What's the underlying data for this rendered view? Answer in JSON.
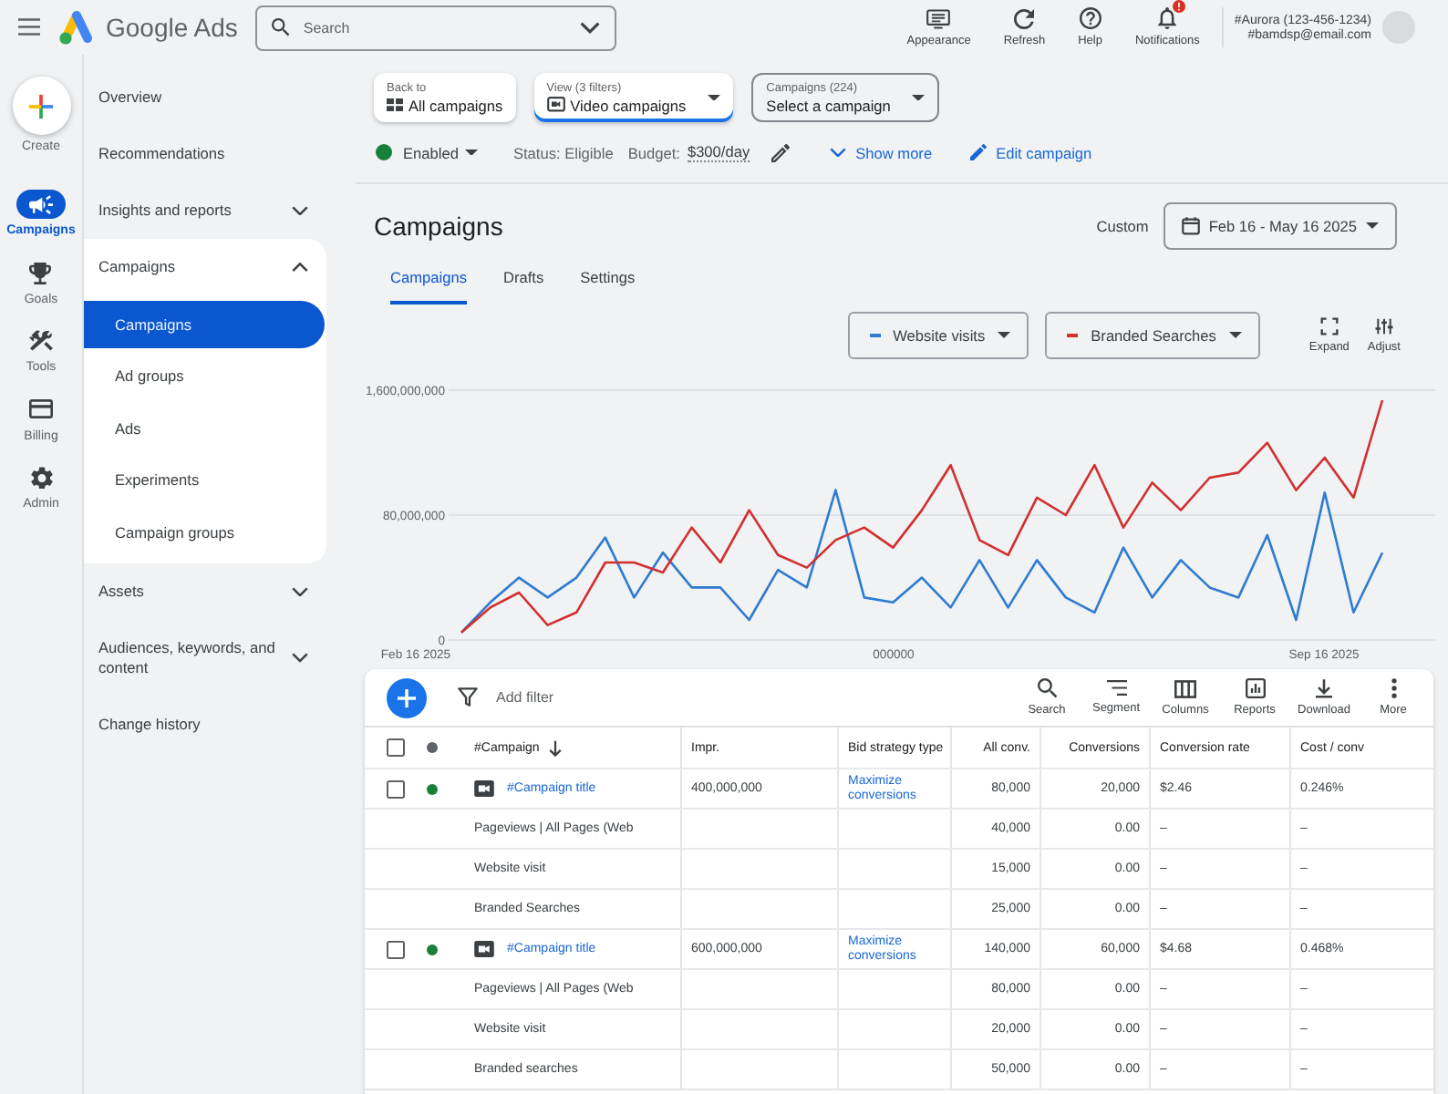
{
  "topbar": {
    "title": "Google Ads",
    "search": {
      "placeholder": "Search"
    },
    "actions": [
      {
        "label": "Appearance",
        "alert": false
      },
      {
        "label": "Refresh",
        "alert": false
      },
      {
        "label": "Help",
        "alert": false
      },
      {
        "label": "Notifications",
        "alert": true
      }
    ],
    "account": {
      "name": "#Aurora (123-456-1234)",
      "email": "#bamdsp@email.com"
    }
  },
  "rail": {
    "create": "Create",
    "items": [
      {
        "label": "Campaigns",
        "selected": true
      },
      {
        "label": "Goals",
        "selected": false
      },
      {
        "label": "Tools",
        "selected": false
      },
      {
        "label": "Billing",
        "selected": false
      },
      {
        "label": "Admin",
        "selected": false
      }
    ]
  },
  "sidebar": {
    "items": [
      {
        "label": "Overview",
        "selected": false
      },
      {
        "label": "Recommendations",
        "selected": false
      },
      {
        "label": "Insights and reports",
        "selected": false,
        "expanded": false
      },
      {
        "label": "Campaigns",
        "selected": false,
        "expanded": true,
        "children": [
          {
            "label": "Campaigns",
            "selected": true
          },
          {
            "label": "Ad groups",
            "selected": false
          },
          {
            "label": "Ads",
            "selected": false
          },
          {
            "label": "Experiments",
            "selected": false
          },
          {
            "label": "Campaign groups",
            "selected": false
          }
        ]
      },
      {
        "label": "Assets",
        "selected": false,
        "expanded": false
      },
      {
        "label": "Audiences, keywords, and content",
        "selected": false,
        "expanded": false
      },
      {
        "label": "Change history",
        "selected": false
      }
    ]
  },
  "context_bar": {
    "back": {
      "caption": "Back to",
      "label": "All campaigns"
    },
    "view": {
      "caption": "View (3 filters)",
      "label": "Video campaigns"
    },
    "campaign_picker": {
      "caption": "Campaigns (224)",
      "label": "Select a campaign"
    }
  },
  "campaign_status": {
    "status": "Enabled",
    "enabled": true,
    "eligibility": "Status: Eligible",
    "budget_label": "Budget:",
    "budget": "$300/day",
    "show_more": "Show more",
    "edit": "Edit campaign"
  },
  "page": {
    "title": "Campaigns",
    "date_label": "Custom",
    "date_range": "Feb 16 - May 16 2025",
    "tabs": [
      {
        "label": "Campaigns",
        "selected": true
      },
      {
        "label": "Drafts",
        "selected": false
      },
      {
        "label": "Settings",
        "selected": false
      }
    ]
  },
  "chart": {
    "metrics": [
      {
        "name": "Website visits",
        "color": "#2f7bd0"
      },
      {
        "name": "Branded Searches",
        "color": "#d32f2f"
      }
    ],
    "tools": [
      "Expand",
      "Adjust"
    ],
    "y_labels": [
      "1,600,000,000",
      "80,000,000",
      "0"
    ],
    "x_labels": [
      "Feb 16 2025",
      "000000",
      "Sep 16 2025"
    ]
  },
  "table": {
    "add_filter": "Add filter",
    "tools": [
      "Search",
      "Segment",
      "Columns",
      "Reports",
      "Download",
      "More"
    ],
    "all_checked": false,
    "columns": [
      {
        "label": "#Campaign",
        "sorted": true
      },
      {
        "label": "Impr.",
        "sorted": false
      },
      {
        "label": "Bid strategy type",
        "sorted": false
      },
      {
        "label": "All conv.",
        "sorted": false
      },
      {
        "label": "Conversions",
        "sorted": false
      },
      {
        "label": "Conversion rate",
        "sorted": false
      },
      {
        "label": "Cost / conv",
        "sorted": false
      }
    ],
    "rows": [
      {
        "kind": "campaign",
        "checked": false,
        "enabled": true,
        "name": "#Campaign title",
        "impr": "400,000,000",
        "bid_strategy": "Maximize conversions",
        "all_conv": "80,000",
        "conversions": "20,000",
        "conv_rate": "$2.46",
        "cost_per_conv": "0.246%"
      },
      {
        "kind": "conversion_action",
        "name": "Pageviews | All Pages (Web",
        "all_conv": "40,000",
        "conversions": "0.00",
        "conv_rate": "–",
        "cost_per_conv": "–"
      },
      {
        "kind": "conversion_action",
        "name": "Website visit",
        "all_conv": "15,000",
        "conversions": "0.00",
        "conv_rate": "–",
        "cost_per_conv": "–"
      },
      {
        "kind": "conversion_action",
        "name": "Branded Searches",
        "all_conv": "25,000",
        "conversions": "0.00",
        "conv_rate": "–",
        "cost_per_conv": "–"
      },
      {
        "kind": "campaign",
        "checked": false,
        "enabled": true,
        "name": "#Campaign title",
        "impr": "600,000,000",
        "bid_strategy": "Maximize conversions",
        "all_conv": "140,000",
        "conversions": "60,000",
        "conv_rate": "$4.68",
        "cost_per_conv": "0.468%"
      },
      {
        "kind": "conversion_action",
        "name": "Pageviews | All Pages (Web",
        "all_conv": "80,000",
        "conversions": "0.00",
        "conv_rate": "–",
        "cost_per_conv": "–"
      },
      {
        "kind": "conversion_action",
        "name": "Website visit",
        "all_conv": "20,000",
        "conversions": "0.00",
        "conv_rate": "–",
        "cost_per_conv": "–"
      },
      {
        "kind": "conversion_action",
        "name": "Branded searches",
        "all_conv": "50,000",
        "conversions": "0.00",
        "conv_rate": "–",
        "cost_per_conv": "–"
      }
    ]
  }
}
